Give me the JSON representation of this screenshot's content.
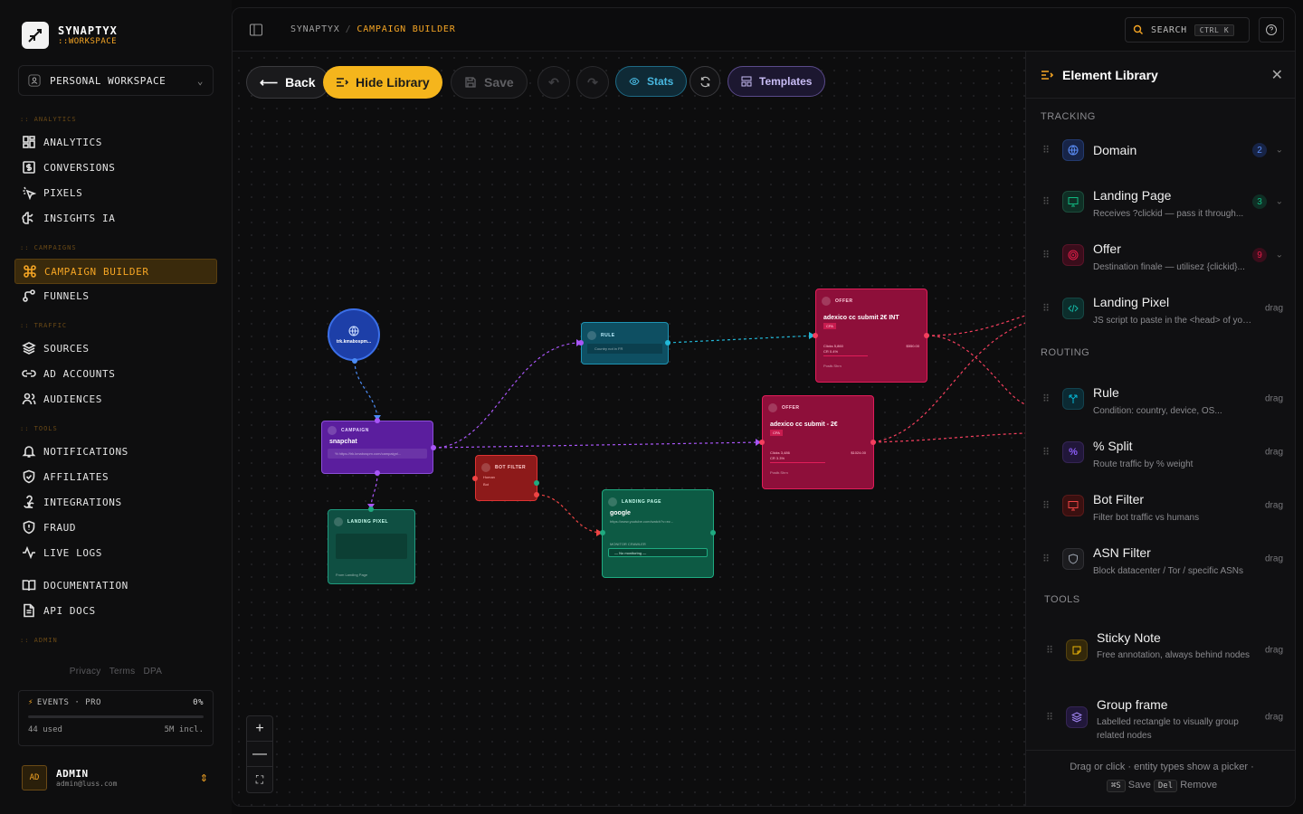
{
  "brand": {
    "name": "SYNAPTYX",
    "sub": "::WORKSPACE"
  },
  "workspace": {
    "label": "PERSONAL WORKSPACE"
  },
  "nav": {
    "sections": {
      "analytics": ":: ANALYTICS",
      "campaigns": ":: CAMPAIGNS",
      "traffic": ":: TRAFFIC",
      "tools": ":: TOOLS",
      "admin": ":: ADMIN"
    },
    "items": [
      {
        "label": "ANALYTICS",
        "icon": "grid-icon"
      },
      {
        "label": "CONVERSIONS",
        "icon": "dollar-icon"
      },
      {
        "label": "PIXELS",
        "icon": "pointer-icon"
      },
      {
        "label": "INSIGHTS IA",
        "icon": "brain-icon"
      },
      {
        "label": "CAMPAIGN BUILDER",
        "icon": "command-icon",
        "active": true
      },
      {
        "label": "FUNNELS",
        "icon": "funnel-icon"
      },
      {
        "label": "SOURCES",
        "icon": "layers-icon"
      },
      {
        "label": "AD ACCOUNTS",
        "icon": "link-icon"
      },
      {
        "label": "AUDIENCES",
        "icon": "users-icon"
      },
      {
        "label": "NOTIFICATIONS",
        "icon": "bell-icon"
      },
      {
        "label": "AFFILIATES",
        "icon": "shield-check-icon"
      },
      {
        "label": "INTEGRATIONS",
        "icon": "webhook-icon"
      },
      {
        "label": "FRAUD",
        "icon": "shield-alert-icon"
      },
      {
        "label": "LIVE LOGS",
        "icon": "activity-icon"
      },
      {
        "label": "DOCUMENTATION",
        "icon": "book-icon"
      },
      {
        "label": "API DOCS",
        "icon": "file-icon"
      }
    ]
  },
  "legal": {
    "privacy": "Privacy",
    "terms": "Terms",
    "dpa": "DPA"
  },
  "events": {
    "label": "EVENTS · PRO",
    "percent": "0%",
    "used": "44 used",
    "included": "5M incl.",
    "progress": 0
  },
  "user": {
    "initials": "AD",
    "name": "ADMIN",
    "email": "admin@luss.com"
  },
  "breadcrumb": {
    "root": "SYNAPTYX",
    "sep": "/",
    "current": "CAMPAIGN BUILDER"
  },
  "search": {
    "label": "SEARCH",
    "shortcut": "CTRL K"
  },
  "toolbar": {
    "back": "Back",
    "hide_library": "Hide Library",
    "save": "Save",
    "stats": "Stats",
    "templates": "Templates"
  },
  "canvas": {
    "domain_node": {
      "title": "trk.kmabospm..."
    },
    "campaign_node": {
      "type": "CAMPAIGN",
      "title": "snapchat",
      "sub": "% https://trk.kmabospm.com/campaign/..."
    },
    "rule_node": {
      "type": "RULE",
      "sub": "Country not in FR"
    },
    "bot_node": {
      "type": "BOT FILTER",
      "human": "Human",
      "bot": "Bot"
    },
    "pixel_node": {
      "type": "LANDING PIXEL",
      "sub": "From Landing Page"
    },
    "landing_node": {
      "type": "LANDING PAGE",
      "title": "google",
      "url": "https://www.youtube.com/watch?v=ez...",
      "monitor": "MONITOR CRAWLER",
      "select": "— No monitoring —"
    },
    "offer1": {
      "type": "OFFER",
      "title": "adexico cc submit 2€ INT",
      "tag": "CPA",
      "clicks": "Clicks 5,860",
      "cr": "CR 0.4%",
      "rev": "$550.00",
      "foot": "Postb.Shrn"
    },
    "offer2": {
      "type": "OFFER",
      "title": "adexico cc submit - 2€",
      "tag": "CPA",
      "clicks": "Clicks 3,486",
      "cr": "CR 3.3%",
      "rev": "$1024.00",
      "foot": "Postb.Shrn"
    }
  },
  "library": {
    "title": "Element Library",
    "groups": {
      "tracking": "TRACKING",
      "routing": "ROUTING",
      "tools": "TOOLS"
    },
    "items": [
      {
        "name": "Domain",
        "desc": "",
        "count": "2",
        "icon": "globe-icon",
        "color": "#3b82f6"
      },
      {
        "name": "Landing Page",
        "desc": "Receives ?clickid — pass it through...",
        "count": "3",
        "icon": "monitor-icon",
        "color": "#10b981"
      },
      {
        "name": "Offer",
        "desc": "Destination finale — utilisez {clickid}...",
        "count": "9",
        "icon": "target-icon",
        "color": "#e11d48"
      },
      {
        "name": "Landing Pixel",
        "desc": "JS script to paste in the <head> of your LP",
        "drag": "drag",
        "icon": "code-icon",
        "color": "#14b8a6"
      },
      {
        "name": "Rule",
        "desc": "Condition: country, device, OS...",
        "drag": "drag",
        "icon": "split-icon",
        "color": "#06b6d4"
      },
      {
        "name": "% Split",
        "desc": "Route traffic by % weight",
        "drag": "drag",
        "icon": "percent-icon",
        "color": "#8b5cf6"
      },
      {
        "name": "Bot Filter",
        "desc": "Filter bot traffic vs humans",
        "drag": "drag",
        "icon": "bot-icon",
        "color": "#dc2626"
      },
      {
        "name": "ASN Filter",
        "desc": "Block datacenter / Tor / specific ASNs",
        "drag": "drag",
        "icon": "shield-icon",
        "color": "#6b7280"
      },
      {
        "name": "Sticky Note",
        "desc": "Free annotation, always behind nodes",
        "drag": "drag",
        "icon": "note-icon",
        "color": "#eab308"
      },
      {
        "name": "Group frame",
        "desc": "Labelled rectangle to visually group related nodes",
        "drag": "drag",
        "icon": "stack-icon",
        "color": "#7c3aed"
      }
    ],
    "footer": {
      "line1": "Drag or click · entity types show a picker ·",
      "save_key": "⌘S",
      "save": "Save",
      "del_key": "Del",
      "remove": "Remove"
    }
  }
}
